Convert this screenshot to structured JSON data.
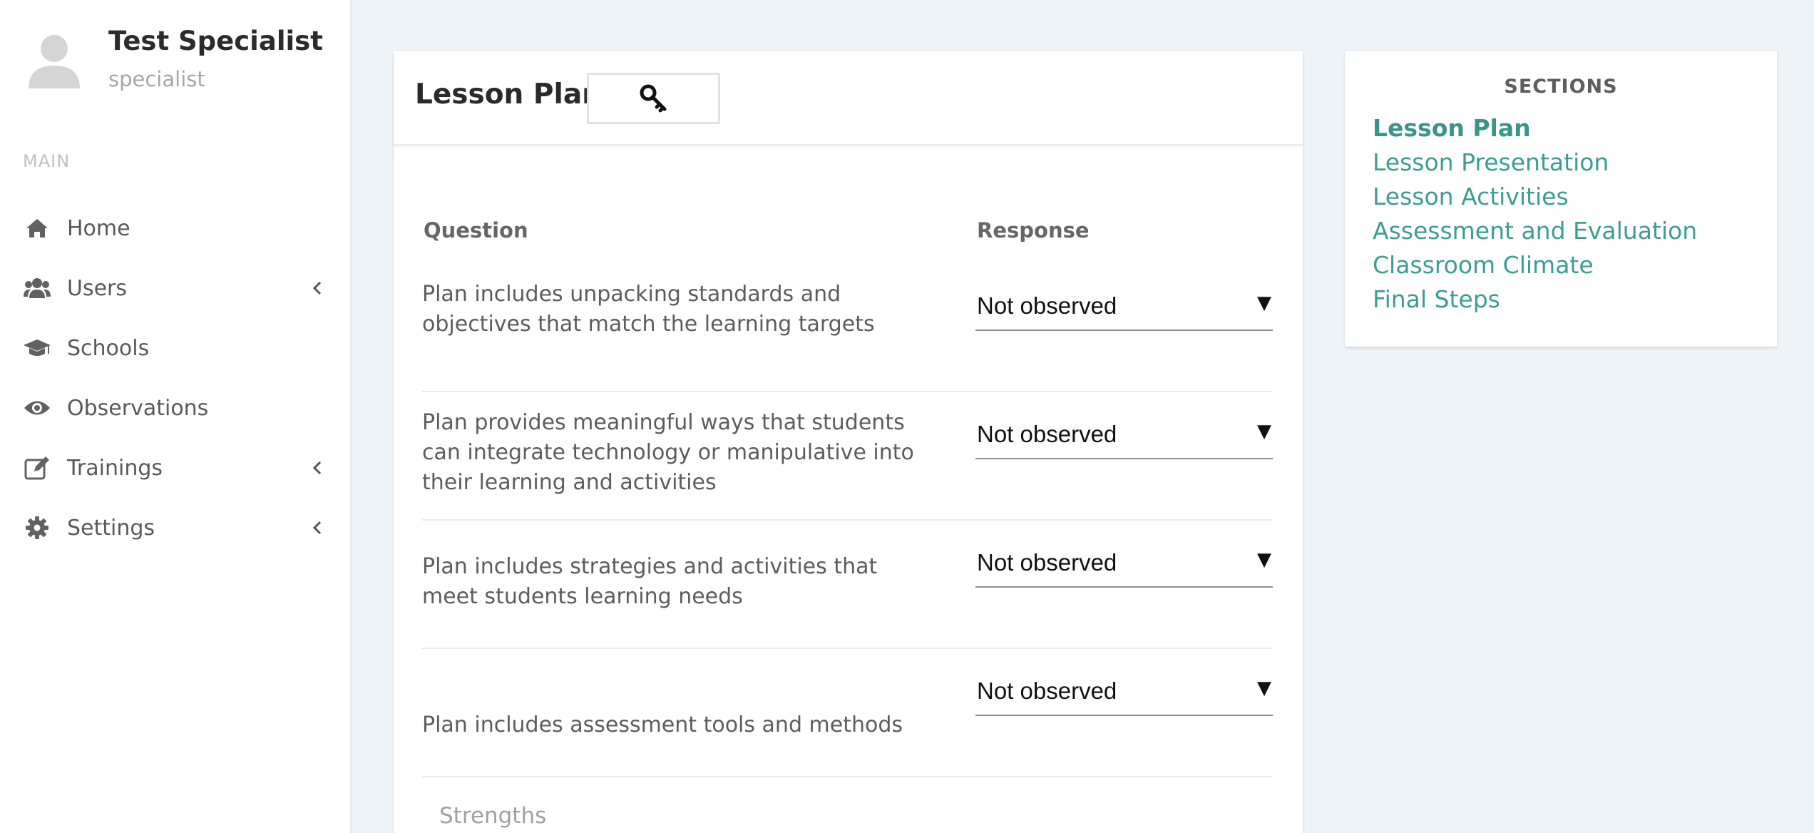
{
  "profile": {
    "name": "Test Specialist",
    "role": "specialist",
    "avatar_icon": "user-avatar-icon"
  },
  "sidebar": {
    "heading": "MAIN",
    "items": [
      {
        "label": "Home",
        "icon": "home-icon",
        "has_submenu": false
      },
      {
        "label": "Users",
        "icon": "users-icon",
        "has_submenu": true
      },
      {
        "label": "Schools",
        "icon": "graduation-cap-icon",
        "has_submenu": false
      },
      {
        "label": "Observations",
        "icon": "eye-icon",
        "has_submenu": false
      },
      {
        "label": "Trainings",
        "icon": "edit-icon",
        "has_submenu": true
      },
      {
        "label": "Settings",
        "icon": "gear-icon",
        "has_submenu": true
      }
    ]
  },
  "main": {
    "title": "Lesson Plan",
    "key_button_icon": "key-icon",
    "columns": {
      "question": "Question",
      "response": "Response"
    },
    "rows": [
      {
        "question": "Plan includes unpacking standards and objectives that match the learning targets",
        "response": "Not observed"
      },
      {
        "question": "Plan provides meaningful ways that students can integrate technology or manipulative into their learning and activities",
        "response": "Not observed"
      },
      {
        "question": "Plan includes strategies and activities that meet students learning needs",
        "response": "Not observed"
      },
      {
        "question": "Plan includes assessment tools and methods",
        "response": "Not observed"
      }
    ],
    "strengths_label": "Strengths"
  },
  "sections": {
    "title": "SECTIONS",
    "items": [
      {
        "label": "Lesson Plan",
        "active": true
      },
      {
        "label": "Lesson Presentation",
        "active": false
      },
      {
        "label": "Lesson Activities",
        "active": false
      },
      {
        "label": "Assessment and Evaluation",
        "active": false
      },
      {
        "label": "Classroom Climate",
        "active": false
      },
      {
        "label": "Final Steps",
        "active": false
      }
    ]
  },
  "colors": {
    "accent": "#3d9c94",
    "background": "#edf3f6",
    "sidebar_icon": "#616161"
  }
}
